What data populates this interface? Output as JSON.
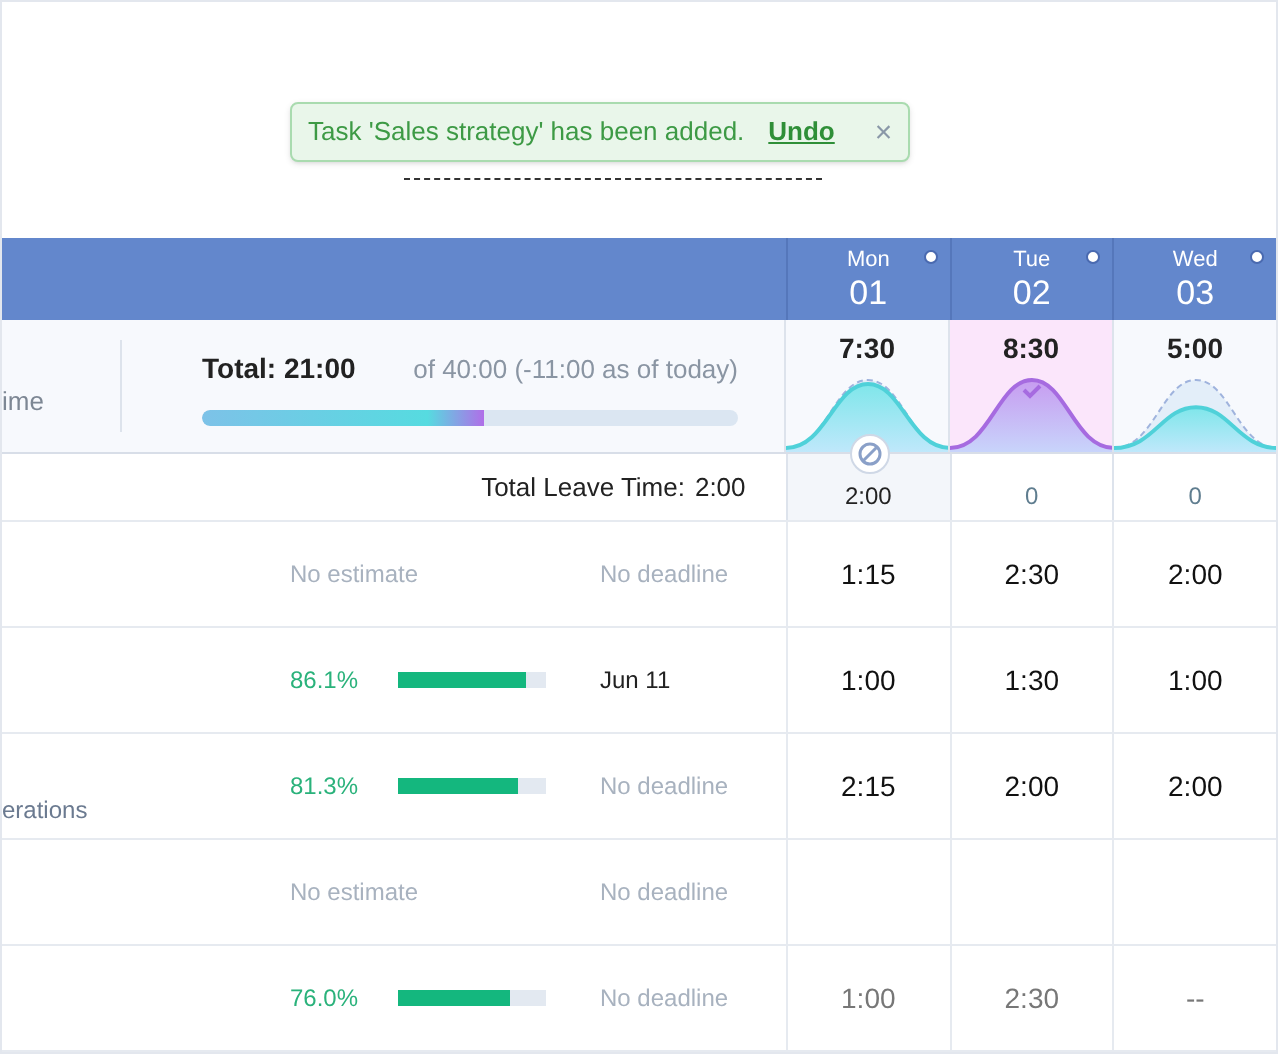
{
  "toast": {
    "message": "Task 'Sales strategy' has been added.",
    "action": "Undo",
    "close": "×"
  },
  "summary": {
    "left_fragment": "ime",
    "total": "Total: 21:00",
    "of": "of 40:00 (-11:00 as of today)",
    "level": 0.525
  },
  "days": [
    {
      "name": "Mon",
      "number": "01",
      "hours": "7:30",
      "kind": "full",
      "selected": false,
      "leave": true,
      "leave_time": "2:00"
    },
    {
      "name": "Tue",
      "number": "02",
      "hours": "8:30",
      "kind": "done",
      "selected": true,
      "leave": false,
      "leave_time": "0"
    },
    {
      "name": "Wed",
      "number": "03",
      "hours": "5:00",
      "kind": "partial",
      "selected": false,
      "leave": false,
      "leave_time": "0"
    }
  ],
  "leave_label": "Total Leave Time:",
  "leave_total": "2:00",
  "tasks": [
    {
      "estimate": {
        "kind": "none",
        "text": "No estimate"
      },
      "deadline": {
        "text": "No deadline",
        "set": false
      },
      "dimmed": false,
      "times": [
        "1:15",
        "2:30",
        "2:00"
      ]
    },
    {
      "estimate": {
        "kind": "progress",
        "text": "86.1%",
        "level": 0.861
      },
      "deadline": {
        "text": "Jun 11",
        "set": true
      },
      "dimmed": false,
      "times": [
        "1:00",
        "1:30",
        "1:00"
      ]
    },
    {
      "title_fragment": "erations",
      "estimate": {
        "kind": "progress",
        "text": "81.3%",
        "level": 0.813
      },
      "deadline": {
        "text": "No deadline",
        "set": false
      },
      "dimmed": false,
      "times": [
        "2:15",
        "2:00",
        "2:00"
      ]
    },
    {
      "estimate": {
        "kind": "none",
        "text": "No estimate"
      },
      "deadline": {
        "text": "No deadline",
        "set": false
      }
    },
    {
      "estimate": {
        "kind": "progress",
        "text": "76.0%",
        "level": 0.76
      },
      "deadline": {
        "text": "No deadline",
        "set": false
      },
      "dimmed": true,
      "times": [
        "1:00",
        "2:30",
        "--"
      ]
    }
  ]
}
